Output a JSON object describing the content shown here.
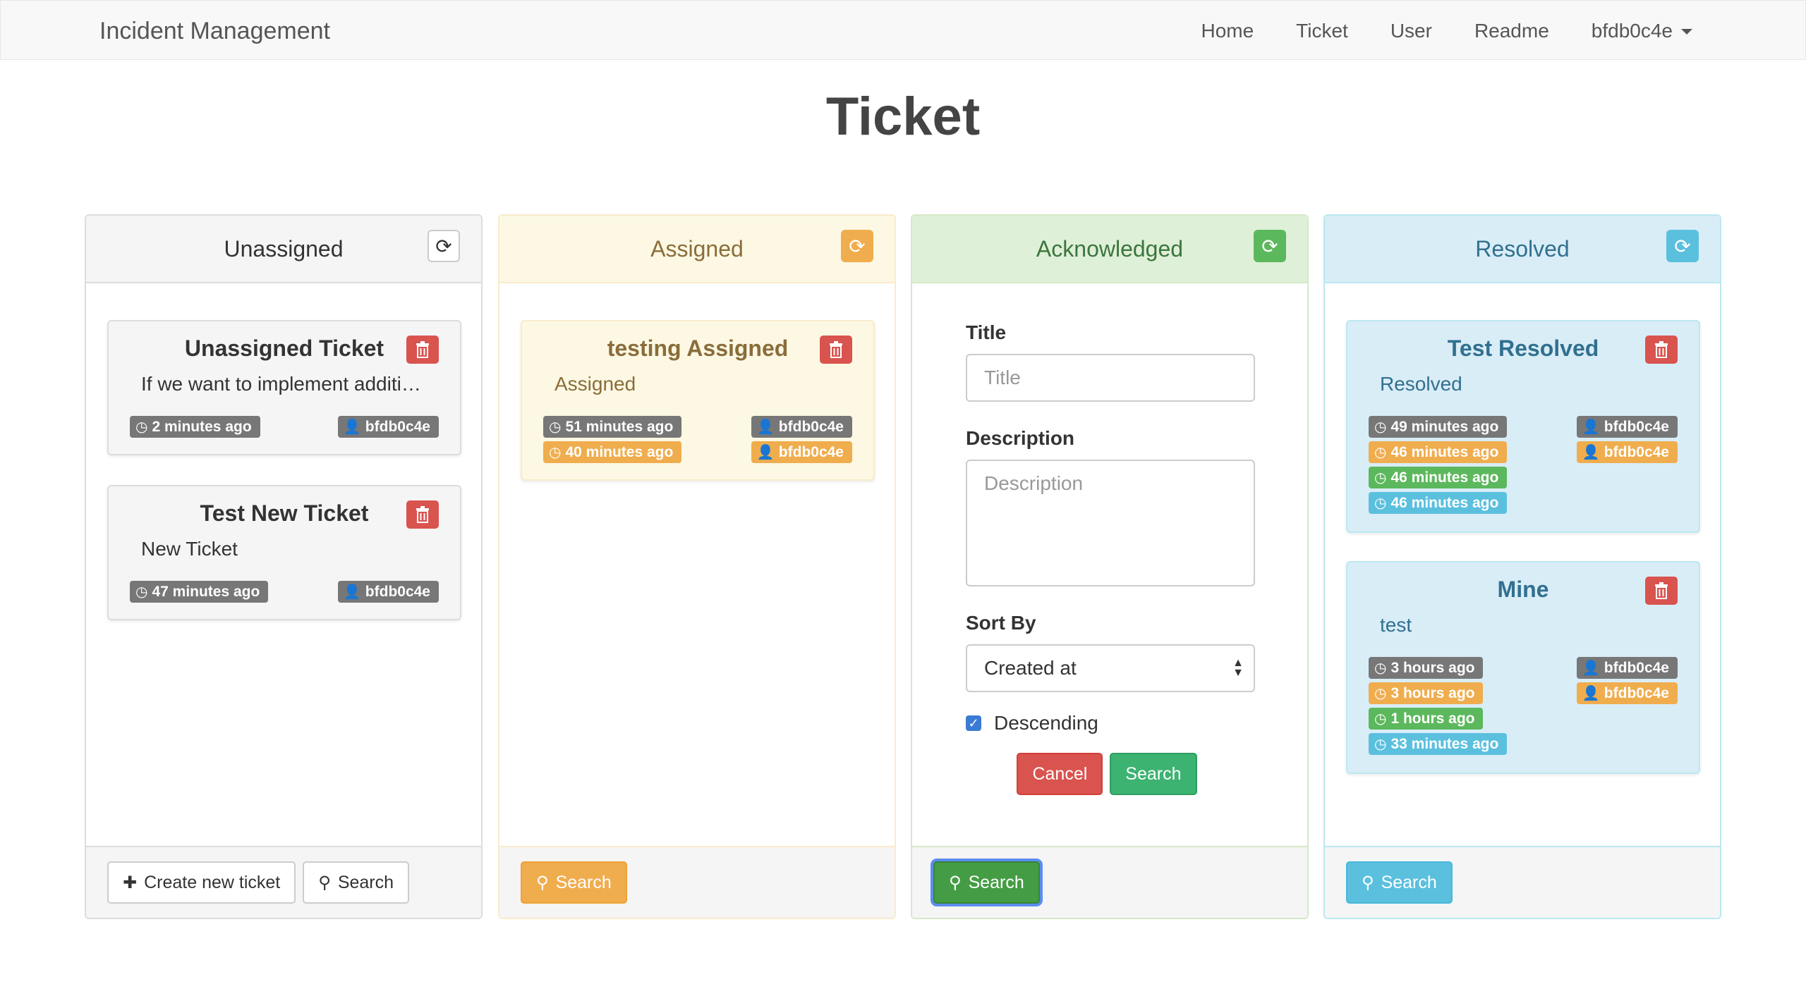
{
  "nav": {
    "brand": "Incident Management",
    "links": [
      "Home",
      "Ticket",
      "User",
      "Readme"
    ],
    "user": "bfdb0c4e"
  },
  "page_title": "Ticket",
  "columns": {
    "unassigned": {
      "title": "Unassigned",
      "tickets": [
        {
          "title": "Unassigned Ticket",
          "desc": "If we want to implement additi…",
          "time": "2 minutes ago",
          "user": "bfdb0c4e"
        },
        {
          "title": "Test New Ticket",
          "desc": "New Ticket",
          "time": "47 minutes ago",
          "user": "bfdb0c4e"
        }
      ],
      "create_label": "Create new ticket",
      "search_label": "Search"
    },
    "assigned": {
      "title": "Assigned",
      "ticket": {
        "title": "testing Assigned",
        "desc": "Assigned",
        "created": "51 minutes ago",
        "assigned": "40 minutes ago",
        "creator": "bfdb0c4e",
        "assignee": "bfdb0c4e"
      },
      "search_label": "Search"
    },
    "acknowledged": {
      "title": "Acknowledged",
      "form": {
        "title_label": "Title",
        "title_placeholder": "Title",
        "desc_label": "Description",
        "desc_placeholder": "Description",
        "sort_label": "Sort By",
        "sort_value": "Created at",
        "desc_check": "Descending",
        "cancel": "Cancel",
        "search": "Search"
      },
      "search_label": "Search"
    },
    "resolved": {
      "title": "Resolved",
      "tickets": [
        {
          "title": "Test Resolved",
          "desc": "Resolved",
          "created": "49 minutes ago",
          "assigned": "46 minutes ago",
          "acknowledged": "46 minutes ago",
          "resolved": "46 minutes ago",
          "creator": "bfdb0c4e",
          "assignee": "bfdb0c4e"
        },
        {
          "title": "Mine",
          "desc": "test",
          "created": "3 hours ago",
          "assigned": "3 hours ago",
          "acknowledged": "1 hours ago",
          "resolved": "33 minutes ago",
          "creator": "bfdb0c4e",
          "assignee": "bfdb0c4e"
        }
      ],
      "search_label": "Search"
    }
  },
  "colors": {
    "warning": "#f0ad4e",
    "success": "#5cb85c",
    "info": "#5bc0de",
    "danger": "#d9534f",
    "default": "#777777"
  }
}
